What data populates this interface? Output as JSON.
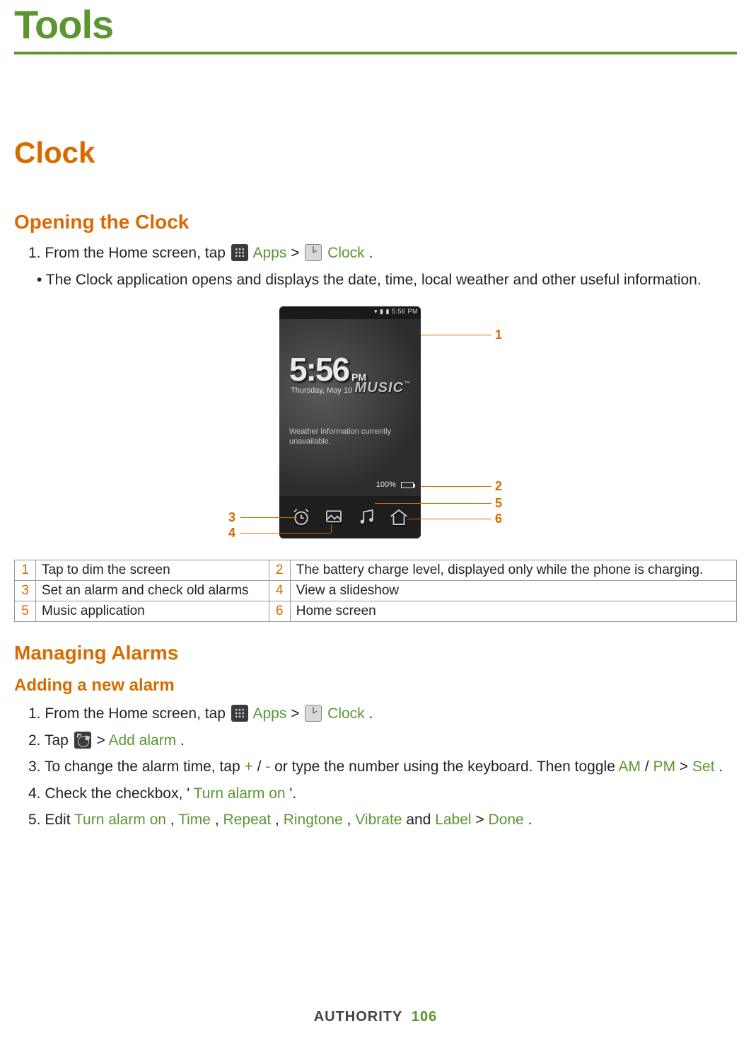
{
  "page_title": "Tools",
  "section1_heading": "Clock",
  "opening_heading": "Opening the Clock",
  "step_open_1_a": "1. From the Home screen, tap ",
  "apps_label": " Apps",
  "sep_gt": " > ",
  "clock_label": " Clock",
  "period": ".",
  "bullet_open": "• The Clock application opens and displays the date, time, local weather and other useful information.",
  "phone": {
    "status_time": "5:56 PM",
    "time": "5:56",
    "pm": "PM",
    "date": "Thursday, May 10",
    "music": "MUSIC",
    "tm": "™",
    "weather": "Weather information currently unavailable.",
    "batt": "100%"
  },
  "callouts": {
    "n1": "1",
    "n2": "2",
    "n3": "3",
    "n4": "4",
    "n5": "5",
    "n6": "6"
  },
  "table": {
    "r1a": "Tap to dim the screen",
    "r1b": "The battery charge level, displayed only while the phone is charging.",
    "r2a": "Set an alarm and check old alarms",
    "r2b": "View a slideshow",
    "r3a": "Music application",
    "r3b": "Home screen"
  },
  "managing_heading": "Managing Alarms",
  "adding_heading": "Adding a new alarm",
  "step_add_1_a": "1. From the Home screen, tap ",
  "step_add_2_a": "2. Tap ",
  "add_alarm_label": "Add alarm",
  "step_add_3_a": "3. To change the alarm time, tap ",
  "plus": "+",
  "slash": "/",
  "minus": "-",
  "step_add_3_b": " or type the number using the keyboard. Then toggle ",
  "am": "AM",
  "pm_lbl": "PM",
  "set": "Set",
  "step_add_4_a": "4. Check the checkbox, '",
  "turn_alarm_on": "Turn alarm on",
  "step_add_4_b": "'.",
  "step_add_5_a": "5. Edit ",
  "time_lbl": "Time",
  "repeat_lbl": "Repeat",
  "ringtone_lbl": "Ringtone",
  "vibrate_lbl": "Vibrate",
  "and": " and ",
  "label_lbl": "Label",
  "done": "Done",
  "comma": ", ",
  "footer_brand": "AUTHORITY",
  "footer_page": "106"
}
